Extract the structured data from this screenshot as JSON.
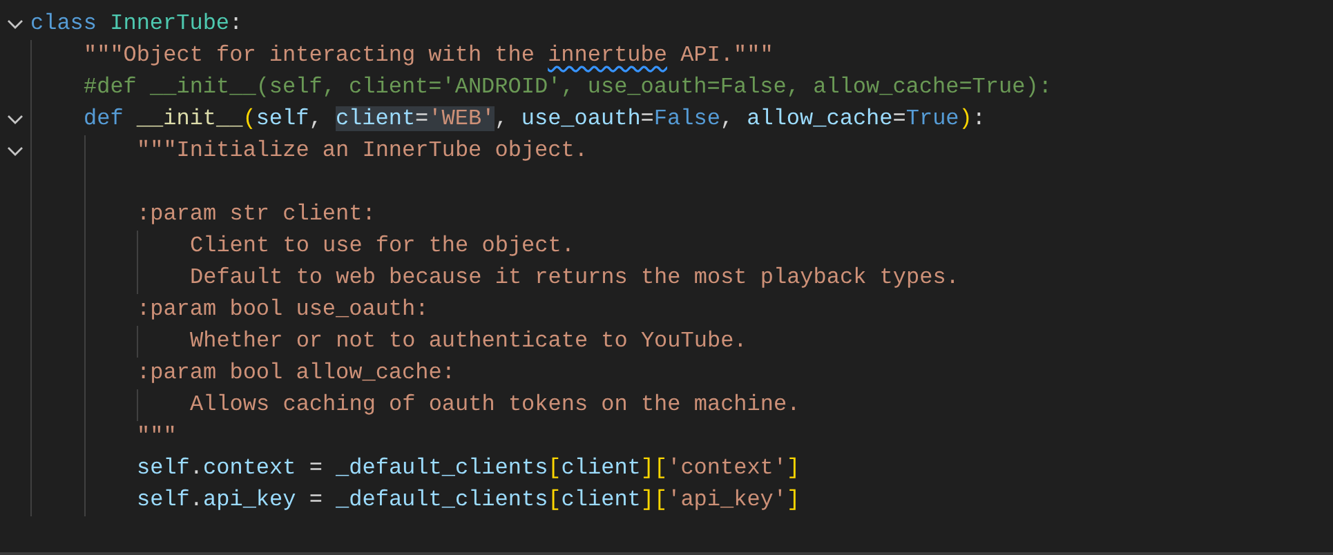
{
  "editor": {
    "lines": [
      {
        "kind": "code",
        "foldable": true,
        "tokens": [
          {
            "t": "class ",
            "kind": "keyword"
          },
          {
            "t": "InnerTube",
            "kind": "type"
          },
          {
            "t": ":",
            "kind": "plain"
          }
        ],
        "children": [
          {
            "kind": "code",
            "foldable": false,
            "tokens": [
              {
                "t": "\"\"\"Object for interacting with the ",
                "kind": "string"
              },
              {
                "t": "innertube",
                "kind": "string",
                "squiggle": true
              },
              {
                "t": " API.\"\"\"",
                "kind": "string"
              }
            ]
          },
          {
            "kind": "code",
            "foldable": false,
            "tokens": [
              {
                "t": "#def __init__(self, client='ANDROID', use_oauth=False, allow_cache=True):",
                "kind": "comment"
              }
            ]
          },
          {
            "kind": "code",
            "foldable": true,
            "tokens": [
              {
                "t": "def ",
                "kind": "keyword"
              },
              {
                "t": "__init__",
                "kind": "function"
              },
              {
                "t": "(",
                "kind": "bracket"
              },
              {
                "t": "self",
                "kind": "variable"
              },
              {
                "t": ", ",
                "kind": "plain"
              },
              {
                "t": "client",
                "kind": "variable",
                "highlight": true
              },
              {
                "t": "=",
                "kind": "plain",
                "highlight": true
              },
              {
                "t": "'WEB'",
                "kind": "string",
                "highlight": true
              },
              {
                "t": ", ",
                "kind": "plain"
              },
              {
                "t": "use_oauth",
                "kind": "variable"
              },
              {
                "t": "=",
                "kind": "plain"
              },
              {
                "t": "False",
                "kind": "keyword"
              },
              {
                "t": ", ",
                "kind": "plain"
              },
              {
                "t": "allow_cache",
                "kind": "variable"
              },
              {
                "t": "=",
                "kind": "plain"
              },
              {
                "t": "True",
                "kind": "keyword"
              },
              {
                "t": ")",
                "kind": "bracket"
              },
              {
                "t": ":",
                "kind": "plain"
              }
            ],
            "children": [
              {
                "kind": "code",
                "foldable": true,
                "tokens": [
                  {
                    "t": "\"\"\"Initialize an InnerTube object.",
                    "kind": "string"
                  }
                ]
              },
              {
                "kind": "blank"
              },
              {
                "kind": "code",
                "foldable": false,
                "tokens": [
                  {
                    "t": ":param str client:",
                    "kind": "string"
                  }
                ],
                "children": [
                  {
                    "kind": "code",
                    "foldable": false,
                    "tokens": [
                      {
                        "t": "Client to use for the object.",
                        "kind": "string"
                      }
                    ]
                  },
                  {
                    "kind": "code",
                    "foldable": false,
                    "tokens": [
                      {
                        "t": "Default to web because it returns the most playback types.",
                        "kind": "string"
                      }
                    ]
                  }
                ]
              },
              {
                "kind": "code",
                "foldable": false,
                "tokens": [
                  {
                    "t": ":param bool use_oauth:",
                    "kind": "string"
                  }
                ],
                "children": [
                  {
                    "kind": "code",
                    "foldable": false,
                    "tokens": [
                      {
                        "t": "Whether or not to authenticate to YouTube.",
                        "kind": "string"
                      }
                    ]
                  }
                ]
              },
              {
                "kind": "code",
                "foldable": false,
                "tokens": [
                  {
                    "t": ":param bool allow_cache:",
                    "kind": "string"
                  }
                ],
                "children": [
                  {
                    "kind": "code",
                    "foldable": false,
                    "tokens": [
                      {
                        "t": "Allows caching of oauth tokens on the machine.",
                        "kind": "string"
                      }
                    ]
                  }
                ]
              },
              {
                "kind": "code",
                "foldable": false,
                "tokens": [
                  {
                    "t": "\"\"\"",
                    "kind": "string"
                  }
                ]
              },
              {
                "kind": "code",
                "foldable": false,
                "tokens": [
                  {
                    "t": "self",
                    "kind": "variable"
                  },
                  {
                    "t": ".",
                    "kind": "plain"
                  },
                  {
                    "t": "context",
                    "kind": "variable"
                  },
                  {
                    "t": " = ",
                    "kind": "plain"
                  },
                  {
                    "t": "_default_clients",
                    "kind": "variable"
                  },
                  {
                    "t": "[",
                    "kind": "bracket"
                  },
                  {
                    "t": "client",
                    "kind": "variable"
                  },
                  {
                    "t": "][",
                    "kind": "bracket"
                  },
                  {
                    "t": "'context'",
                    "kind": "string"
                  },
                  {
                    "t": "]",
                    "kind": "bracket"
                  }
                ]
              },
              {
                "kind": "code",
                "foldable": false,
                "tokens": [
                  {
                    "t": "self",
                    "kind": "variable"
                  },
                  {
                    "t": ".",
                    "kind": "plain"
                  },
                  {
                    "t": "api_key",
                    "kind": "variable"
                  },
                  {
                    "t": " = ",
                    "kind": "plain"
                  },
                  {
                    "t": "_default_clients",
                    "kind": "variable"
                  },
                  {
                    "t": "[",
                    "kind": "bracket"
                  },
                  {
                    "t": "client",
                    "kind": "variable"
                  },
                  {
                    "t": "][",
                    "kind": "bracket"
                  },
                  {
                    "t": "'api_key'",
                    "kind": "string"
                  },
                  {
                    "t": "]",
                    "kind": "bracket"
                  }
                ]
              }
            ]
          }
        ]
      }
    ]
  }
}
